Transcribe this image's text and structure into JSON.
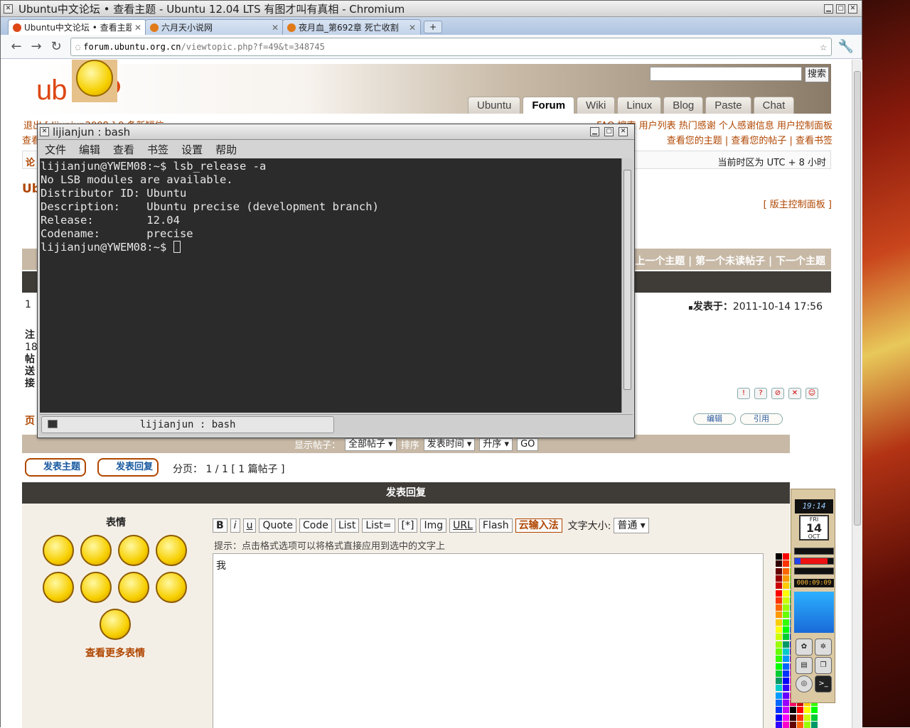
{
  "browser": {
    "window_title": "Ubuntu中文论坛 • 查看主题 - Ubuntu 12.04 LTS 有图才叫有真相 - Chromium",
    "tabs": [
      {
        "label": "Ubuntu中文论坛 • 查看主题",
        "active": true
      },
      {
        "label": "六月天小说网",
        "active": false
      },
      {
        "label": "夜月血_第692章 死亡收割",
        "active": false
      }
    ],
    "url_host": "forum.ubuntu.org.cn",
    "url_path": "/viewtopic.php?f=49&t=348745"
  },
  "site": {
    "logo_text_left": "ub",
    "logo_text_right": "u",
    "search_button": "搜索",
    "nav_tabs": [
      "Ubuntu",
      "Forum",
      "Wiki",
      "Linux",
      "Blog",
      "Paste",
      "Chat"
    ],
    "active_nav": "Forum",
    "userbar_left": "退出 [ lijunjun2008 ]   0 条新短信",
    "userbar_right": "FAQ   搜索   用户列表   热门感谢   个人感谢信息   用户控制面板",
    "userbar2_left": "查看",
    "userbar2_right": "查看您的主题 | 查看您的帖子 | 查看书签",
    "timezone": "当前时区为 UTC + 8 小时",
    "forum_link_prefix": "论",
    "page_title_prefix": "Ub",
    "mod_panel": "[ 版主控制面板 ]",
    "topic_nav": "上一个主题 | 第一个未读帖子 | 下一个主题",
    "post_label_prefix": "1 ",
    "post_time_label": "发表于：",
    "post_time": "2011-10-14 17:56",
    "side_labels": [
      "注",
      "18",
      "帖",
      "送",
      "接"
    ],
    "page_label_prefix": "页",
    "edit_button": "编辑",
    "quote_button": "引用"
  },
  "display_bar": {
    "display_label": "显示帖子：",
    "posts_filter": "全部帖子",
    "sort_label": "排序",
    "sort_by": "发表时间",
    "order": "升序",
    "go": "GO"
  },
  "actions": {
    "new_topic": "发表主题",
    "reply": "发表回复",
    "pagination": "分页： 1 / 1   [ 1 篇帖子 ]"
  },
  "reply": {
    "header": "发表回复",
    "emoticons_title": "表情",
    "more_emoticons": "查看更多表情",
    "toolbar": [
      "B",
      "i",
      "u",
      "Quote",
      "Code",
      "List",
      "List=",
      "[*]",
      "Img",
      "URL",
      "Flash"
    ],
    "cloud_ime": "云输入法",
    "font_size_label": "文字大小:",
    "font_size_value": "普通",
    "hint": "提示：点击格式选项可以将格式直接应用到选中的文字上",
    "editor_text": "我"
  },
  "dock": {
    "clock": "19:14",
    "cal_dow": "FRI",
    "cal_day": "14",
    "cal_month": "OCT",
    "timer": "000:09:09"
  },
  "terminal": {
    "title": "lijianjun : bash",
    "menu": [
      "文件",
      "编辑",
      "查看",
      "书签",
      "设置",
      "帮助"
    ],
    "lines": [
      "lijianjun@YWEM08:~$ lsb_release -a",
      "No LSB modules are available.",
      "Distributor ID: Ubuntu",
      "Description:    Ubuntu precise (development branch)",
      "Release:        12.04",
      "Codename:       precise"
    ],
    "prompt": "lijianjun@YWEM08:~$ ",
    "tab_label": "lijianjun : bash"
  }
}
